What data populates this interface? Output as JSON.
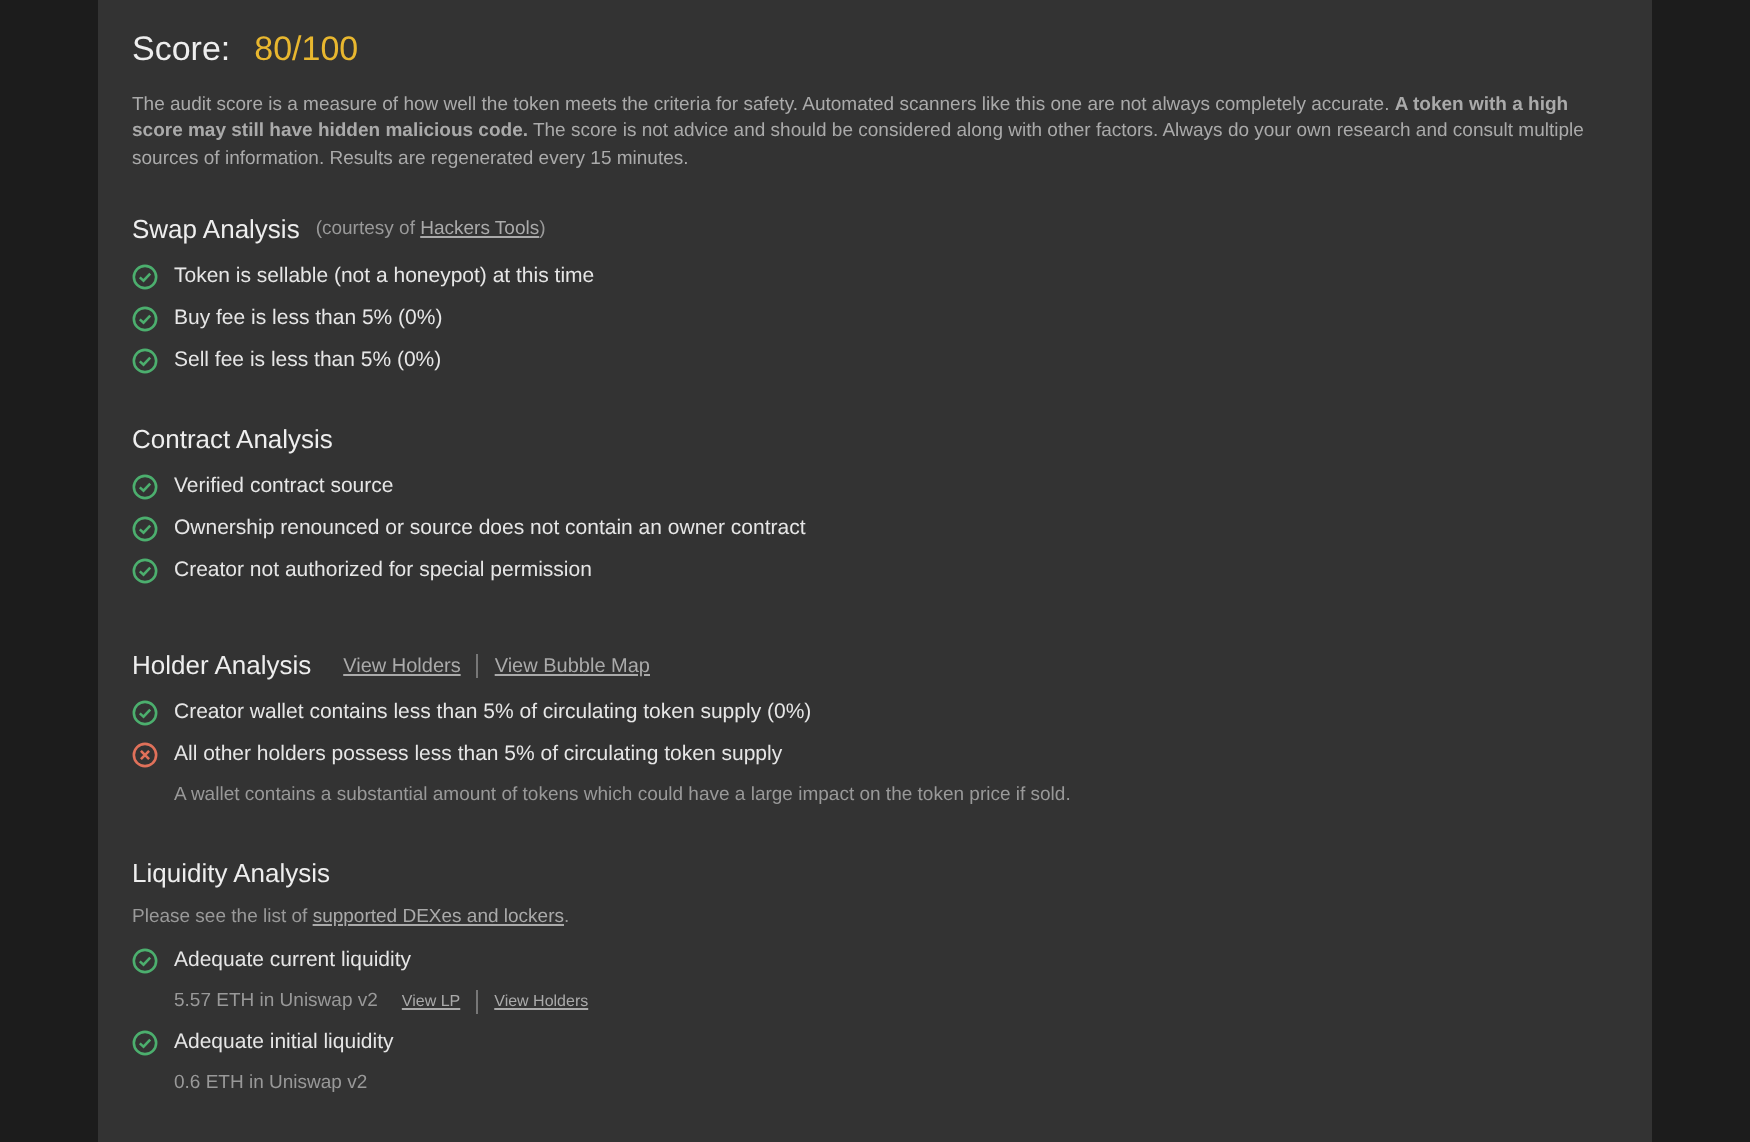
{
  "score": {
    "label": "Score:",
    "value": "80/100"
  },
  "description": "The audit score is a measure of how well the token meets the criteria for safety.  Automated scanners like this one are not always completely accurate.  **A token with a high score may still have hidden malicious code.** The score is not advice and should be considered along with other factors. Always do your own research and consult multiple sources of information.  Results are regenerated every 15 minutes.",
  "sections": [
    {
      "title": "Swap Analysis",
      "attribution": {
        "prefix": "(courtesy of",
        "link": "Hackers Tools",
        "suffix": ")"
      },
      "items": [
        {
          "text": "Token is sellable (not a honeypot) at this time",
          "passed": true
        },
        {
          "text": "Buy fee is less than 5% (0%)",
          "passed": true
        },
        {
          "text": "Sell fee is less than 5% (0%)",
          "passed": true
        }
      ]
    },
    {
      "title": "Contract Analysis",
      "items": [
        {
          "text": "Verified contract source",
          "passed": true
        },
        {
          "text": "Ownership renounced or source does not contain an owner contract",
          "passed": true
        },
        {
          "text": "Creator not authorized for special permission",
          "passed": true
        }
      ]
    },
    {
      "title": "Holder Analysis",
      "links": [
        "View Holders",
        "View Bubble Map"
      ],
      "items": [
        {
          "text": "Creator wallet contains less than 5% of circulating token supply (0%)",
          "passed": true
        },
        {
          "text": "All other holders possess less than 5% of circulating token supply",
          "passed": false,
          "detail": {
            "text": "A wallet contains a substantial amount of tokens which could have a large impact on the token price if sold."
          }
        }
      ]
    },
    {
      "title": "Liquidity Analysis",
      "intro": {
        "prefix": "Please see the list of",
        "link": "supported DEXes and lockers",
        "suffix": "."
      },
      "items": [
        {
          "text": "Adequate current liquidity",
          "passed": true,
          "detail": {
            "text": "5.57 ETH in Uniswap v2",
            "links": [
              "View LP",
              "View Holders"
            ]
          }
        },
        {
          "text": "Adequate initial liquidity",
          "passed": true,
          "detail": {
            "text": "0.6 ETH in Uniswap v2"
          }
        }
      ]
    }
  ]
}
